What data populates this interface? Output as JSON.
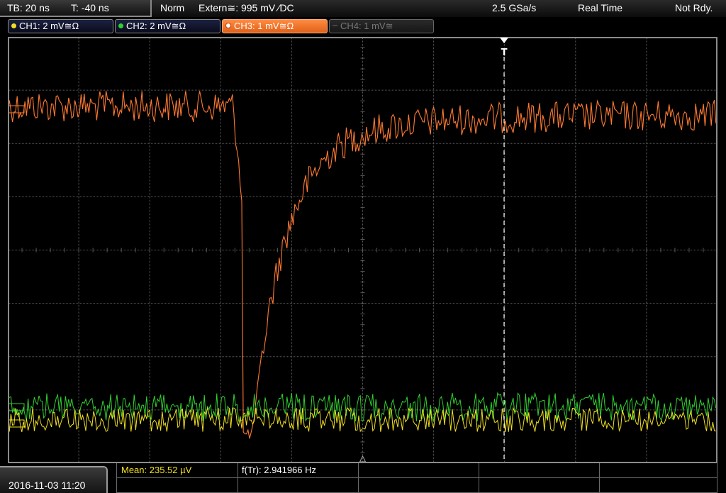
{
  "topbar": {
    "timebase": "TB: 20 ns",
    "trigger_time": "T: -40 ns",
    "trigger_mode": "Norm",
    "trigger_source": "Extern≅: 995 mV ∕DC",
    "sample_rate": "2.5 GSa/s",
    "acq_mode": "Real Time",
    "status": "Not Rdy."
  },
  "channels": [
    {
      "label": "CH1: 2 mV≅Ω",
      "color": "#f0e020"
    },
    {
      "label": "CH2: 2 mV≅Ω",
      "color": "#30d030"
    },
    {
      "label": "CH3: 1 mV≅Ω",
      "color": "#ff8c40"
    },
    {
      "label": "CH4: 1 mV≅",
      "color": "#666666"
    }
  ],
  "markers": {
    "trigger": "T"
  },
  "measurements": {
    "mean": "Mean: 235.52 µV",
    "freq": "f(Tr): 2.941966 Hz"
  },
  "datetime": "2016-11-03 11:20",
  "colors": {
    "ch1": "#f0e020",
    "ch2": "#30d030",
    "ch3": "#ff7a30",
    "grid": "#5a5a5a",
    "mean_text": "#f0e020"
  }
}
